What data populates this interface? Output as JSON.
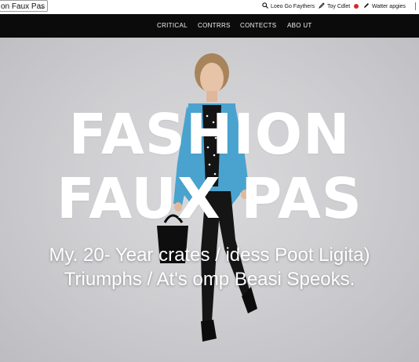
{
  "topbar": {
    "site_select_value": "on Faux Pas",
    "util_items": [
      {
        "icon": "search-icon",
        "label": "Loeo Go Faythers"
      },
      {
        "icon": "pen-icon",
        "label": "Toy Cdlet"
      },
      {
        "icon": "edit-icon",
        "label": "Watter apgies"
      }
    ],
    "notification_color": "#d8272b"
  },
  "nav": {
    "items": [
      "CRITICAL",
      "CONTRRS",
      "CONTECTS",
      "ABO UT"
    ]
  },
  "hero": {
    "title_line1": "FASHION",
    "title_line2": "FAUX PAS",
    "subtitle_line1": "My. 20- Year crates / idess Poot Ligita)",
    "subtitle_line2": "Triumphs /  At's omp Beasi Speoks.",
    "jacket_color": "#4aa3cf"
  }
}
